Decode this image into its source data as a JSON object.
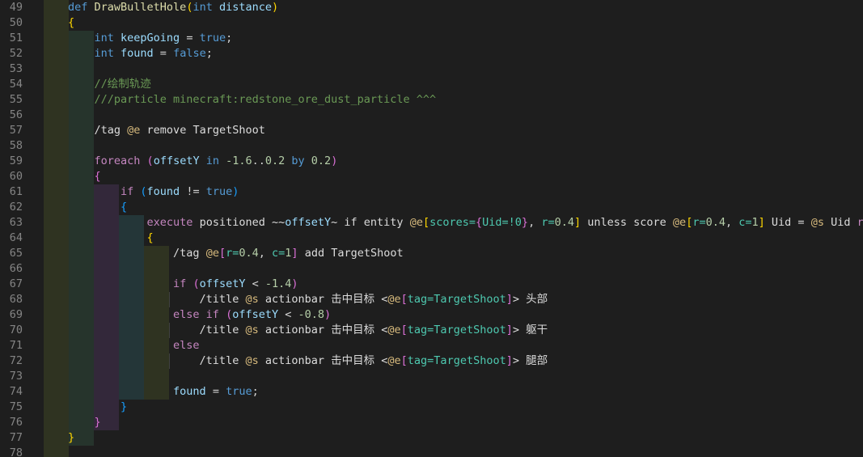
{
  "editor": {
    "lines": [
      {
        "num": "49",
        "guides": 1,
        "tokens": [
          [
            "kw",
            "def "
          ],
          [
            "fn",
            "DrawBulletHole"
          ],
          [
            "br1",
            "("
          ],
          [
            "kw",
            "int"
          ],
          [
            "var",
            " distance"
          ],
          [
            "br1",
            ")"
          ]
        ]
      },
      {
        "num": "50",
        "guides": 1,
        "tokens": [
          [
            "br1",
            "{"
          ]
        ]
      },
      {
        "num": "51",
        "guides": 2,
        "tokens": [
          [
            "kw",
            "    int "
          ],
          [
            "var",
            "keepGoing"
          ],
          [
            "txt",
            " = "
          ],
          [
            "kw",
            "true"
          ],
          [
            "txt",
            ";"
          ]
        ]
      },
      {
        "num": "52",
        "guides": 2,
        "tokens": [
          [
            "kw",
            "    int "
          ],
          [
            "var",
            "found"
          ],
          [
            "txt",
            " = "
          ],
          [
            "kw",
            "false"
          ],
          [
            "txt",
            ";"
          ]
        ]
      },
      {
        "num": "53",
        "guides": 2,
        "tokens": []
      },
      {
        "num": "54",
        "guides": 2,
        "tokens": [
          [
            "cmt",
            "    //绘制轨迹"
          ]
        ]
      },
      {
        "num": "55",
        "guides": 2,
        "tokens": [
          [
            "cmt",
            "    ///particle minecraft:redstone_ore_dust_particle ^^^"
          ]
        ]
      },
      {
        "num": "56",
        "guides": 2,
        "tokens": []
      },
      {
        "num": "57",
        "guides": 2,
        "tokens": [
          [
            "cmd",
            "    /tag "
          ],
          [
            "sel",
            "@e"
          ],
          [
            "cmd",
            " remove TargetShoot"
          ]
        ]
      },
      {
        "num": "58",
        "guides": 2,
        "tokens": []
      },
      {
        "num": "59",
        "guides": 2,
        "tokens": [
          [
            "ctl",
            "    foreach "
          ],
          [
            "br2",
            "("
          ],
          [
            "var",
            "offsetY"
          ],
          [
            "kw",
            " in "
          ],
          [
            "num",
            "-1.6"
          ],
          [
            "txt",
            ".."
          ],
          [
            "num",
            "0.2"
          ],
          [
            "kw",
            " by "
          ],
          [
            "num",
            "0.2"
          ],
          [
            "br2",
            ")"
          ]
        ]
      },
      {
        "num": "60",
        "guides": 2,
        "tokens": [
          [
            "br2",
            "    {"
          ]
        ]
      },
      {
        "num": "61",
        "guides": 3,
        "tokens": [
          [
            "ctl",
            "        if "
          ],
          [
            "br3",
            "("
          ],
          [
            "var",
            "found"
          ],
          [
            "txt",
            " != "
          ],
          [
            "kw",
            "true"
          ],
          [
            "br3",
            ")"
          ]
        ]
      },
      {
        "num": "62",
        "guides": 3,
        "tokens": [
          [
            "br3",
            "        {"
          ]
        ]
      },
      {
        "num": "63",
        "guides": 4,
        "tokens": [
          [
            "ctl",
            "            execute "
          ],
          [
            "cmd",
            "positioned ~~"
          ],
          [
            "var",
            "offsetY"
          ],
          [
            "cmd",
            "~ if entity "
          ],
          [
            "sel",
            "@e"
          ],
          [
            "br1",
            "["
          ],
          [
            "tag",
            "scores="
          ],
          [
            "br2",
            "{"
          ],
          [
            "tag",
            "Uid=!0"
          ],
          [
            "br2",
            "}"
          ],
          [
            "txt",
            ", "
          ],
          [
            "tag",
            "r="
          ],
          [
            "num",
            "0.4"
          ],
          [
            "br1",
            "]"
          ],
          [
            "cmd",
            " unless score "
          ],
          [
            "sel",
            "@e"
          ],
          [
            "br1",
            "["
          ],
          [
            "tag",
            "r="
          ],
          [
            "num",
            "0.4"
          ],
          [
            "txt",
            ", "
          ],
          [
            "tag",
            "c="
          ],
          [
            "num",
            "1"
          ],
          [
            "br1",
            "]"
          ],
          [
            "cmd",
            " Uid = "
          ],
          [
            "sel",
            "@s"
          ],
          [
            "cmd",
            " Uid "
          ],
          [
            "ctl",
            "run"
          ]
        ]
      },
      {
        "num": "64",
        "guides": 4,
        "tokens": [
          [
            "br1",
            "            {"
          ]
        ]
      },
      {
        "num": "65",
        "guides": 5,
        "tokens": [
          [
            "cmd",
            "                /tag "
          ],
          [
            "sel",
            "@e"
          ],
          [
            "br2",
            "["
          ],
          [
            "tag",
            "r="
          ],
          [
            "num",
            "0.4"
          ],
          [
            "txt",
            ", "
          ],
          [
            "tag",
            "c="
          ],
          [
            "num",
            "1"
          ],
          [
            "br2",
            "]"
          ],
          [
            "cmd",
            " add TargetShoot"
          ]
        ]
      },
      {
        "num": "66",
        "guides": 5,
        "tokens": []
      },
      {
        "num": "67",
        "guides": 5,
        "tokens": [
          [
            "ctl",
            "                if "
          ],
          [
            "br2",
            "("
          ],
          [
            "var",
            "offsetY"
          ],
          [
            "txt",
            " < "
          ],
          [
            "num",
            "-1.4"
          ],
          [
            "br2",
            ")"
          ]
        ]
      },
      {
        "num": "68",
        "guides": 6,
        "tokens": [
          [
            "cmd",
            "                    /title "
          ],
          [
            "sel",
            "@s"
          ],
          [
            "cmd",
            " actionbar 击中目标 <"
          ],
          [
            "sel",
            "@e"
          ],
          [
            "br2",
            "["
          ],
          [
            "tag",
            "tag=TargetShoot"
          ],
          [
            "br2",
            "]"
          ],
          [
            "cmd",
            "> 头部"
          ]
        ]
      },
      {
        "num": "69",
        "guides": 5,
        "tokens": [
          [
            "ctl",
            "                else if "
          ],
          [
            "br2",
            "("
          ],
          [
            "var",
            "offsetY"
          ],
          [
            "txt",
            " < "
          ],
          [
            "num",
            "-0.8"
          ],
          [
            "br2",
            ")"
          ]
        ]
      },
      {
        "num": "70",
        "guides": 6,
        "tokens": [
          [
            "cmd",
            "                    /title "
          ],
          [
            "sel",
            "@s"
          ],
          [
            "cmd",
            " actionbar 击中目标 <"
          ],
          [
            "sel",
            "@e"
          ],
          [
            "br2",
            "["
          ],
          [
            "tag",
            "tag=TargetShoot"
          ],
          [
            "br2",
            "]"
          ],
          [
            "cmd",
            "> 躯干"
          ]
        ]
      },
      {
        "num": "71",
        "guides": 5,
        "tokens": [
          [
            "ctl",
            "                else"
          ]
        ]
      },
      {
        "num": "72",
        "guides": 6,
        "tokens": [
          [
            "cmd",
            "                    /title "
          ],
          [
            "sel",
            "@s"
          ],
          [
            "cmd",
            " actionbar 击中目标 <"
          ],
          [
            "sel",
            "@e"
          ],
          [
            "br2",
            "["
          ],
          [
            "tag",
            "tag=TargetShoot"
          ],
          [
            "br2",
            "]"
          ],
          [
            "cmd",
            "> 腿部"
          ]
        ]
      },
      {
        "num": "73",
        "guides": 5,
        "tokens": []
      },
      {
        "num": "74",
        "guides": 5,
        "tokens": [
          [
            "var",
            "                found"
          ],
          [
            "txt",
            " = "
          ],
          [
            "kw",
            "true"
          ],
          [
            "txt",
            ";"
          ]
        ]
      },
      {
        "num": "75",
        "guides": 3,
        "tokens": [
          [
            "br3",
            "        }"
          ]
        ]
      },
      {
        "num": "76",
        "guides": 3,
        "tokens": [
          [
            "br2",
            "    }"
          ]
        ]
      },
      {
        "num": "77",
        "guides": 2,
        "tokens": [
          [
            "br1",
            "}"
          ]
        ]
      },
      {
        "num": "78",
        "guides": 1,
        "tokens": []
      }
    ]
  },
  "colors": {
    "background": "#1e1e1e",
    "line_number": "#858585",
    "keyword": "#569cd6",
    "control": "#c586c0",
    "function": "#dcdcaa",
    "variable": "#9cdcfe",
    "number": "#b5cea8",
    "comment": "#6a9955",
    "selector": "#d7ba7d",
    "argument": "#4ec9b0"
  }
}
